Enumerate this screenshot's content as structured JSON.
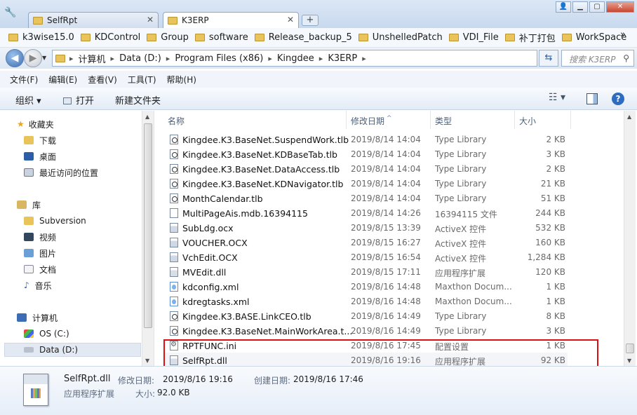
{
  "tabs": [
    {
      "label": "SelfRpt",
      "active": false
    },
    {
      "label": "K3ERP",
      "active": true
    }
  ],
  "favorites": [
    "k3wise15.0",
    "KDControl",
    "Group",
    "software",
    "Release_backup_5",
    "UnshelledPatch",
    "VDI_File",
    "补丁打包",
    "WorkSpace"
  ],
  "favorites_more": "»",
  "address": {
    "crumbs": [
      "计算机",
      "Data (D:)",
      "Program Files (x86)",
      "Kingdee",
      "K3ERP"
    ],
    "search_placeholder": "搜索 K3ERP"
  },
  "menu": [
    "文件(F)",
    "编辑(E)",
    "查看(V)",
    "工具(T)",
    "帮助(H)"
  ],
  "toolbar": {
    "organize": "组织 ▾",
    "open": "打开",
    "new_folder": "新建文件夹"
  },
  "nav": {
    "favorites_header": "收藏夹",
    "favorites": [
      "下载",
      "桌面",
      "最近访问的位置"
    ],
    "library_header": "库",
    "libraries": [
      "Subversion",
      "视频",
      "图片",
      "文档",
      "音乐"
    ],
    "computer_header": "计算机",
    "drives": [
      "OS (C:)",
      "Data (D:)"
    ]
  },
  "columns": {
    "name": "名称",
    "date": "修改日期",
    "type": "类型",
    "size": "大小"
  },
  "files": [
    {
      "name": "Kingdee.K3.BaseNet.SuspendWork.tlb",
      "date": "2019/8/14 14:04",
      "type": "Type Library",
      "size": "2 KB",
      "icon": "tlb"
    },
    {
      "name": "Kingdee.K3.BaseNet.KDBaseTab.tlb",
      "date": "2019/8/14 14:04",
      "type": "Type Library",
      "size": "3 KB",
      "icon": "tlb"
    },
    {
      "name": "Kingdee.K3.BaseNet.DataAccess.tlb",
      "date": "2019/8/14 14:04",
      "type": "Type Library",
      "size": "2 KB",
      "icon": "tlb"
    },
    {
      "name": "Kingdee.K3.BaseNet.KDNavigator.tlb",
      "date": "2019/8/14 14:04",
      "type": "Type Library",
      "size": "21 KB",
      "icon": "tlb"
    },
    {
      "name": "MonthCalendar.tlb",
      "date": "2019/8/14 14:04",
      "type": "Type Library",
      "size": "51 KB",
      "icon": "tlb"
    },
    {
      "name": "MultiPageAis.mdb.16394115",
      "date": "2019/8/14 14:26",
      "type": "16394115 文件",
      "size": "244 KB",
      "icon": "file"
    },
    {
      "name": "SubLdg.ocx",
      "date": "2019/8/15 13:39",
      "type": "ActiveX 控件",
      "size": "532 KB",
      "icon": "ocx"
    },
    {
      "name": "VOUCHER.OCX",
      "date": "2019/8/15 16:27",
      "type": "ActiveX 控件",
      "size": "160 KB",
      "icon": "ocx"
    },
    {
      "name": "VchEdit.OCX",
      "date": "2019/8/15 16:54",
      "type": "ActiveX 控件",
      "size": "1,284 KB",
      "icon": "ocx"
    },
    {
      "name": "MVEdit.dll",
      "date": "2019/8/15 17:11",
      "type": "应用程序扩展",
      "size": "120 KB",
      "icon": "dll"
    },
    {
      "name": "kdconfig.xml",
      "date": "2019/8/16 14:48",
      "type": "Maxthon Docum...",
      "size": "1 KB",
      "icon": "xml"
    },
    {
      "name": "kdregtasks.xml",
      "date": "2019/8/16 14:48",
      "type": "Maxthon Docum...",
      "size": "1 KB",
      "icon": "xml"
    },
    {
      "name": "Kingdee.K3.BASE.LinkCEO.tlb",
      "date": "2019/8/16 14:49",
      "type": "Type Library",
      "size": "8 KB",
      "icon": "tlb"
    },
    {
      "name": "Kingdee.K3.BaseNet.MainWorkArea.t...",
      "date": "2019/8/16 14:49",
      "type": "Type Library",
      "size": "3 KB",
      "icon": "tlb"
    },
    {
      "name": "RPTFUNC.ini",
      "date": "2019/8/16 17:45",
      "type": "配置设置",
      "size": "1 KB",
      "icon": "ini"
    },
    {
      "name": "SelfRpt.dll",
      "date": "2019/8/16 19:16",
      "type": "应用程序扩展",
      "size": "92 KB",
      "icon": "dll"
    }
  ],
  "details": {
    "filename": "SelfRpt.dll",
    "modified_label": "修改日期:",
    "modified": "2019/8/16 19:16",
    "created_label": "创建日期:",
    "created": "2019/8/16 17:46",
    "type": "应用程序扩展",
    "size_label": "大小:",
    "size": "92.0 KB"
  },
  "colors": {
    "highlight_box": "#e01010",
    "folder": "#e8c45a"
  }
}
